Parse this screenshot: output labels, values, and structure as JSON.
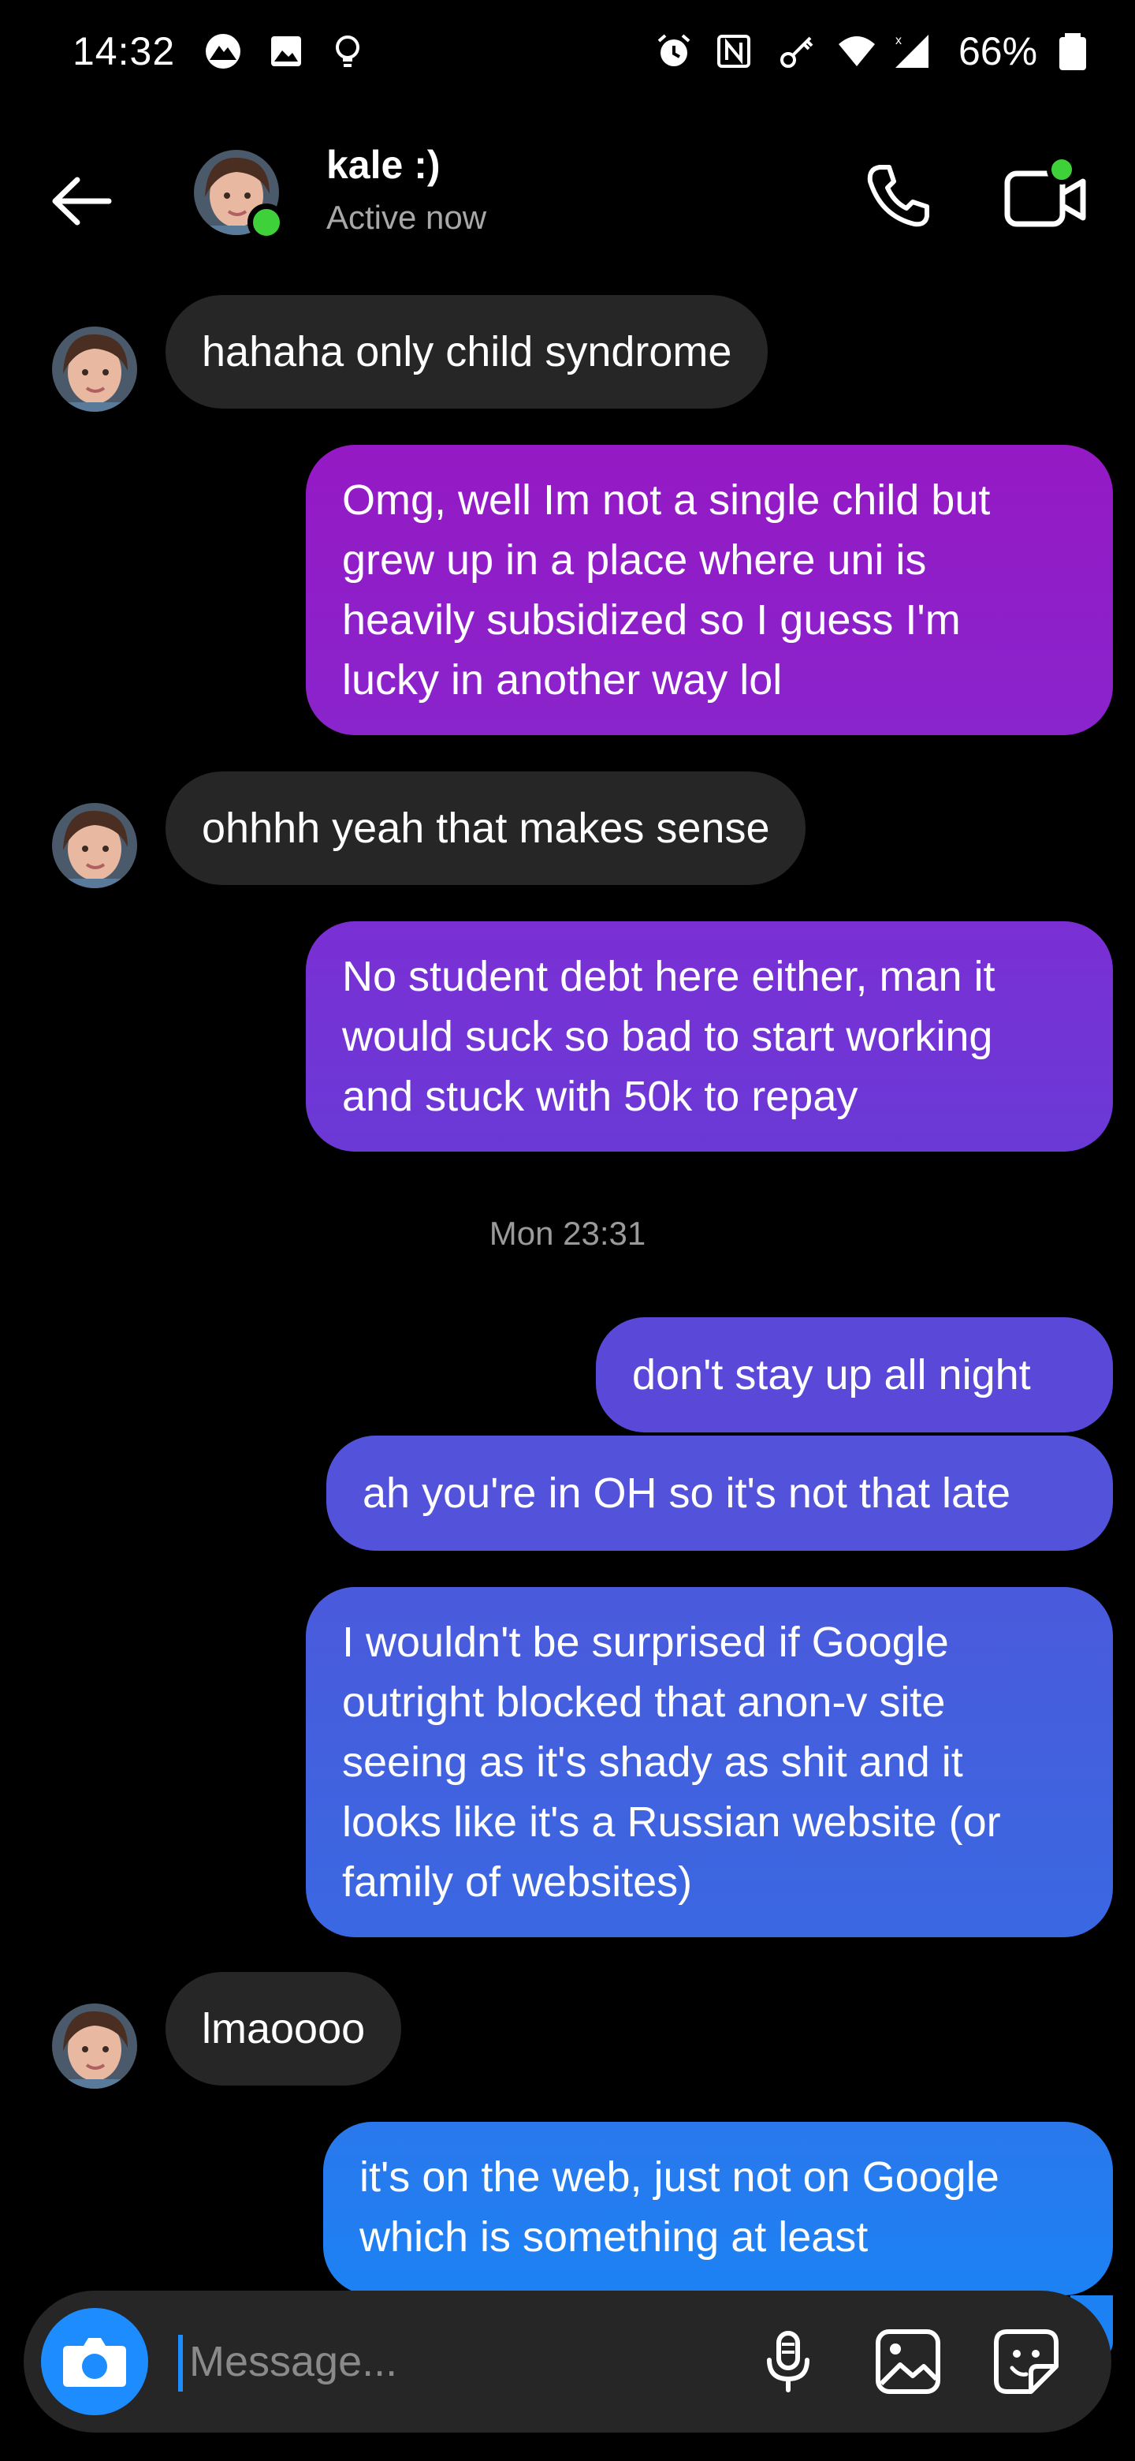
{
  "status_bar": {
    "time": "14:32",
    "battery": "66%"
  },
  "header": {
    "name": "kale :)",
    "status": "Active now"
  },
  "messages": [
    {
      "dir": "in",
      "text": "hahaha only child syndrome"
    },
    {
      "dir": "out",
      "lines": [
        "Omg, well Im not a single child but",
        "grew up in a place where uni is",
        "heavily subsidized so I guess I'm",
        "lucky in another way lol"
      ]
    },
    {
      "dir": "in",
      "text": "ohhhh yeah that makes sense"
    },
    {
      "dir": "out",
      "lines": [
        "No student debt here either, man it",
        "would suck so bad to start working",
        "and stuck with 50k to repay"
      ]
    },
    {
      "dir": "out",
      "text": "don't stay up all night"
    },
    {
      "dir": "out",
      "text": "ah you're in OH so it's not that late"
    },
    {
      "dir": "out",
      "lines": [
        "I wouldn't be surprised if Google",
        "outright blocked that anon-v site",
        "seeing as it's shady as shit and it",
        "looks like it's a Russian website (or",
        "family of websites)"
      ]
    },
    {
      "dir": "in",
      "text": "lmaoooo"
    },
    {
      "dir": "out",
      "lines": [
        "it's on the web, just not on Google",
        "which is something at least"
      ]
    }
  ],
  "timestamp": "Mon 23:31",
  "composer": {
    "placeholder": "Message..."
  },
  "colors": {
    "bubble_in": "#262626",
    "accent": "#1c8cff",
    "online": "#3fd13a",
    "gradient_top": "#9b1ec8",
    "gradient_bottom": "#1c82f4"
  }
}
